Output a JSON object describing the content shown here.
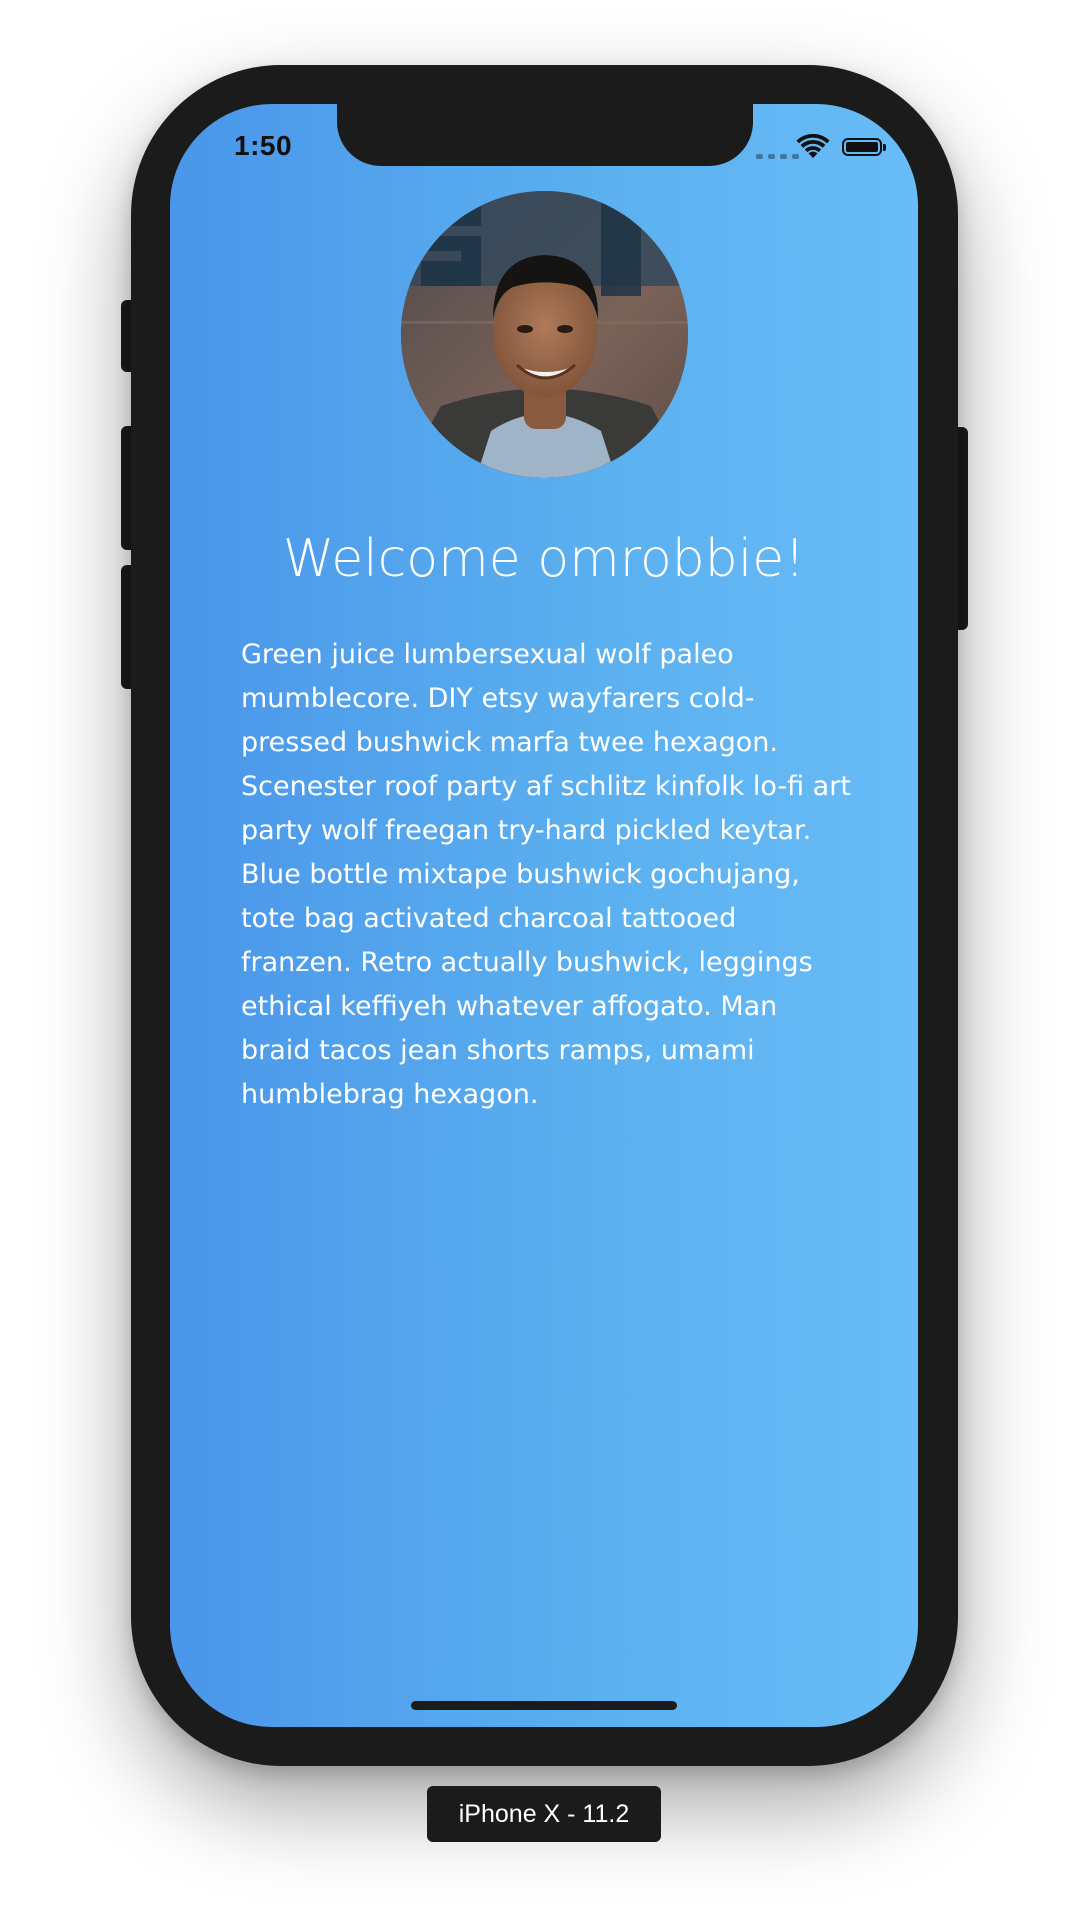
{
  "status_bar": {
    "time": "1:50",
    "wifi_icon": "wifi-icon",
    "battery_icon": "battery-icon",
    "signal_icon": "cellular-signal-icon"
  },
  "profile": {
    "avatar": "profile-photo",
    "welcome": "Welcome omrobbie!",
    "bio": "Green juice lumbersexual wolf paleo mumblecore. DIY etsy wayfarers cold-pressed bushwick marfa twee hexagon. Scenester roof party af schlitz kinfolk lo-fi art party wolf freegan try-hard pickled keytar. Blue bottle mixtape bushwick gochujang, tote bag activated charcoal tattooed franzen. Retro actually bushwick, leggings ethical keffiyeh whatever affogato. Man braid tacos jean shorts ramps, umami humblebrag hexagon."
  },
  "simulator": {
    "device_label": "iPhone X - 11.2"
  },
  "colors": {
    "gradient_start": "#4a96ea",
    "gradient_end": "#68bcf7",
    "device_frame": "#1b1b1b",
    "text": "#ffffff"
  }
}
